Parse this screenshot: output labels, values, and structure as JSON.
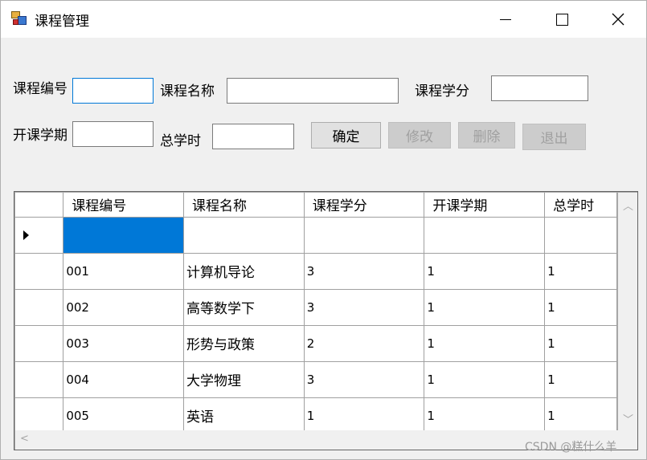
{
  "window": {
    "title": "课程管理",
    "icon": "app-form-icon"
  },
  "form": {
    "course_id_label": "课程编号",
    "course_id_value": "",
    "course_name_label": "课程名称",
    "course_name_value": "",
    "credit_label": "课程学分",
    "credit_value": "",
    "semester_label": "开课学期",
    "semester_value": "",
    "hours_label": "总学时",
    "hours_value": ""
  },
  "buttons": {
    "confirm": "确定",
    "modify": "修改",
    "delete": "删除",
    "exit": "退出"
  },
  "grid": {
    "columns": [
      "课程编号",
      "课程名称",
      "课程学分",
      "开课学期",
      "总学时"
    ],
    "rows": [
      [
        "001",
        "计算机导论",
        "3",
        "1",
        "1"
      ],
      [
        "002",
        "高等数学下",
        "3",
        "1",
        "1"
      ],
      [
        "003",
        "形势与政策",
        "2",
        "1",
        "1"
      ],
      [
        "004",
        "大学物理",
        "3",
        "1",
        "1"
      ],
      [
        "005",
        "英语",
        "1",
        "1",
        "1"
      ]
    ]
  },
  "watermark": "CSDN @糕什么羊"
}
